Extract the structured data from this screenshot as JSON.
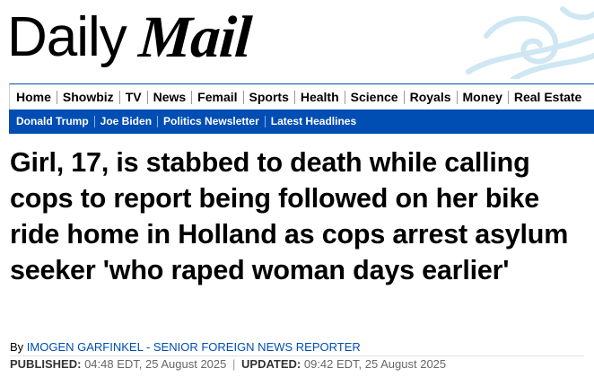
{
  "masthead": {
    "logo_daily": "Daily",
    "logo_mail": "Mail"
  },
  "nav_primary": [
    "Home",
    "Showbiz",
    "TV",
    "News",
    "Femail",
    "Sports",
    "Health",
    "Science",
    "Royals",
    "Money",
    "Real Estate"
  ],
  "nav_secondary": [
    "Donald Trump",
    "Joe Biden",
    "Politics Newsletter",
    "Latest Headlines"
  ],
  "article": {
    "headline": "Girl, 17, is stabbed to death while calling cops to report being followed on her bike ride home in Holland as cops arrest asylum seeker 'who raped woman days earlier'",
    "byline_prefix": "By ",
    "author": "IMOGEN GARFINKEL - SENIOR FOREIGN NEWS REPORTER",
    "published_label": "PUBLISHED:",
    "published": "04:48 EDT, 25 August 2025",
    "separator": "|",
    "updated_label": "UPDATED:",
    "updated": "09:42 EDT, 25 August 2025"
  },
  "colors": {
    "brand_blue": "#004db3",
    "decorative_wave": "#cfe7f2"
  }
}
